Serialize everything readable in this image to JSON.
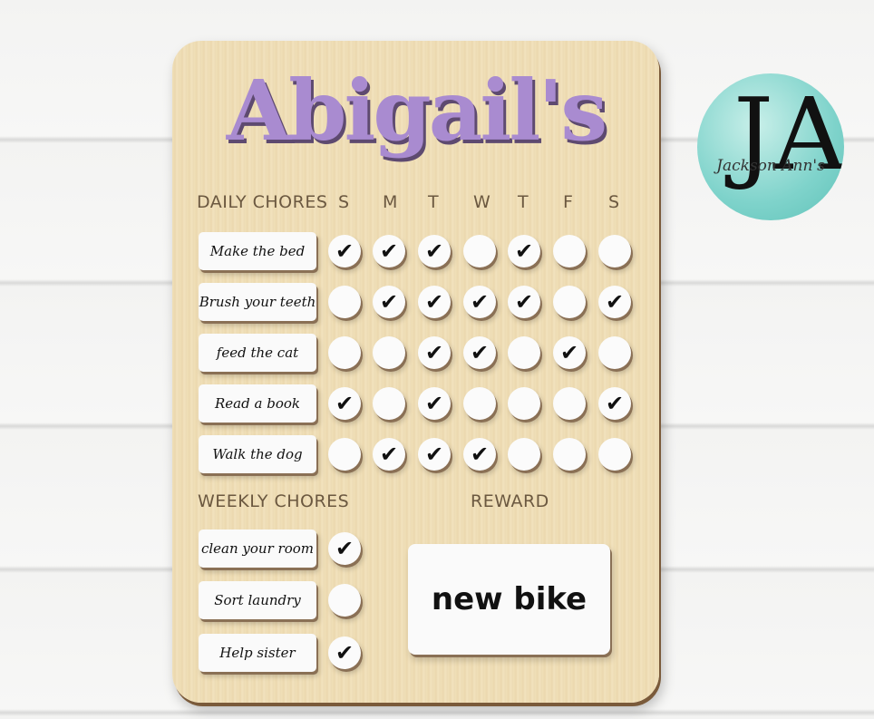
{
  "title": "Abigail's",
  "daily_header": "DAILY CHORES",
  "days": [
    "S",
    "M",
    "T",
    "W",
    "T",
    "F",
    "S"
  ],
  "daily_chores": [
    {
      "label": "Make the bed",
      "checks": [
        true,
        true,
        true,
        false,
        true,
        false,
        false
      ]
    },
    {
      "label": "Brush your teeth",
      "checks": [
        false,
        true,
        true,
        true,
        true,
        false,
        true
      ]
    },
    {
      "label": "feed the cat",
      "checks": [
        false,
        false,
        true,
        true,
        false,
        true,
        false
      ]
    },
    {
      "label": "Read a book",
      "checks": [
        true,
        false,
        true,
        false,
        false,
        false,
        true
      ]
    },
    {
      "label": "Walk the dog",
      "checks": [
        false,
        true,
        true,
        true,
        false,
        false,
        false
      ]
    }
  ],
  "weekly_header": "WEEKLY CHORES",
  "weekly_chores": [
    {
      "label": "clean your room",
      "checked": true
    },
    {
      "label": "Sort laundry",
      "checked": false
    },
    {
      "label": "Help sister",
      "checked": true
    }
  ],
  "reward_header": "REWARD",
  "reward": "new bike",
  "logo": {
    "monogram": "JA",
    "name": "Jackson Ann's"
  },
  "colors": {
    "title": "#a98bd0",
    "wood": "#f0dfb8"
  }
}
